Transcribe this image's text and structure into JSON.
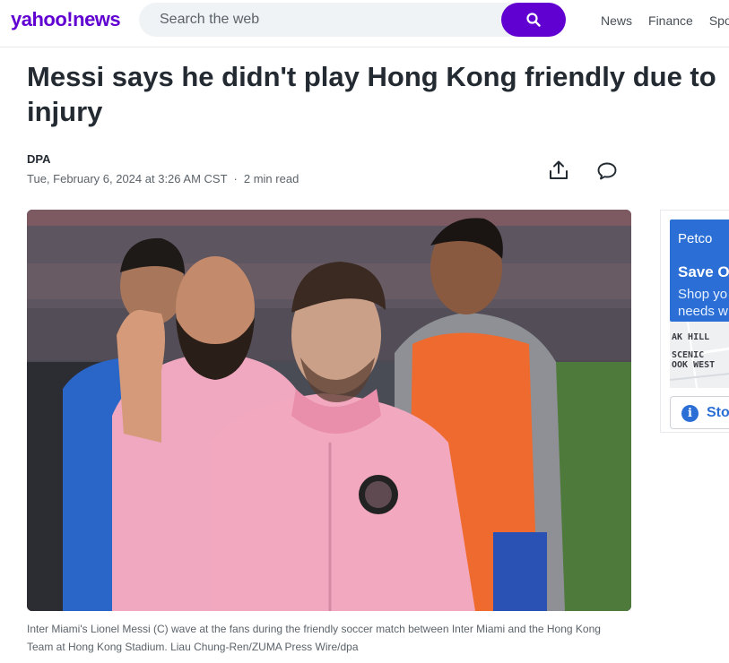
{
  "header": {
    "logo_brand": "yahoo",
    "logo_mark": "!",
    "logo_section": "news",
    "search_placeholder": "Search the web",
    "nav": [
      "News",
      "Finance",
      "Spo"
    ]
  },
  "article": {
    "headline": "Messi says he didn't play Hong Kong friendly due to injury",
    "source": "DPA",
    "date": "Tue, February 6, 2024 at 3:26 AM CST",
    "separator": "·",
    "read_time": "2 min read",
    "photo_caption": "Inter Miami's Lionel Messi (C) wave at the fans during the friendly soccer match between Inter Miami and the Hong Kong Team at Hong Kong Stadium. Liau Chung-Ren/ZUMA Press Wire/dpa"
  },
  "ad": {
    "brand": "Petco",
    "headline": "Save O",
    "body_line1": "Shop yo",
    "body_line2": "needs w",
    "map_labels": [
      "AK HILL",
      "SCENIC",
      "OOK WEST"
    ],
    "store_label": "Sto"
  },
  "colors": {
    "brand_purple": "#6001d2",
    "ad_blue": "#2b6fd6",
    "text_dark": "#232a31",
    "text_muted": "#5b636a"
  },
  "icons": {
    "search": "search-icon",
    "share": "share-icon",
    "comment": "comment-icon",
    "info": "info-icon"
  }
}
